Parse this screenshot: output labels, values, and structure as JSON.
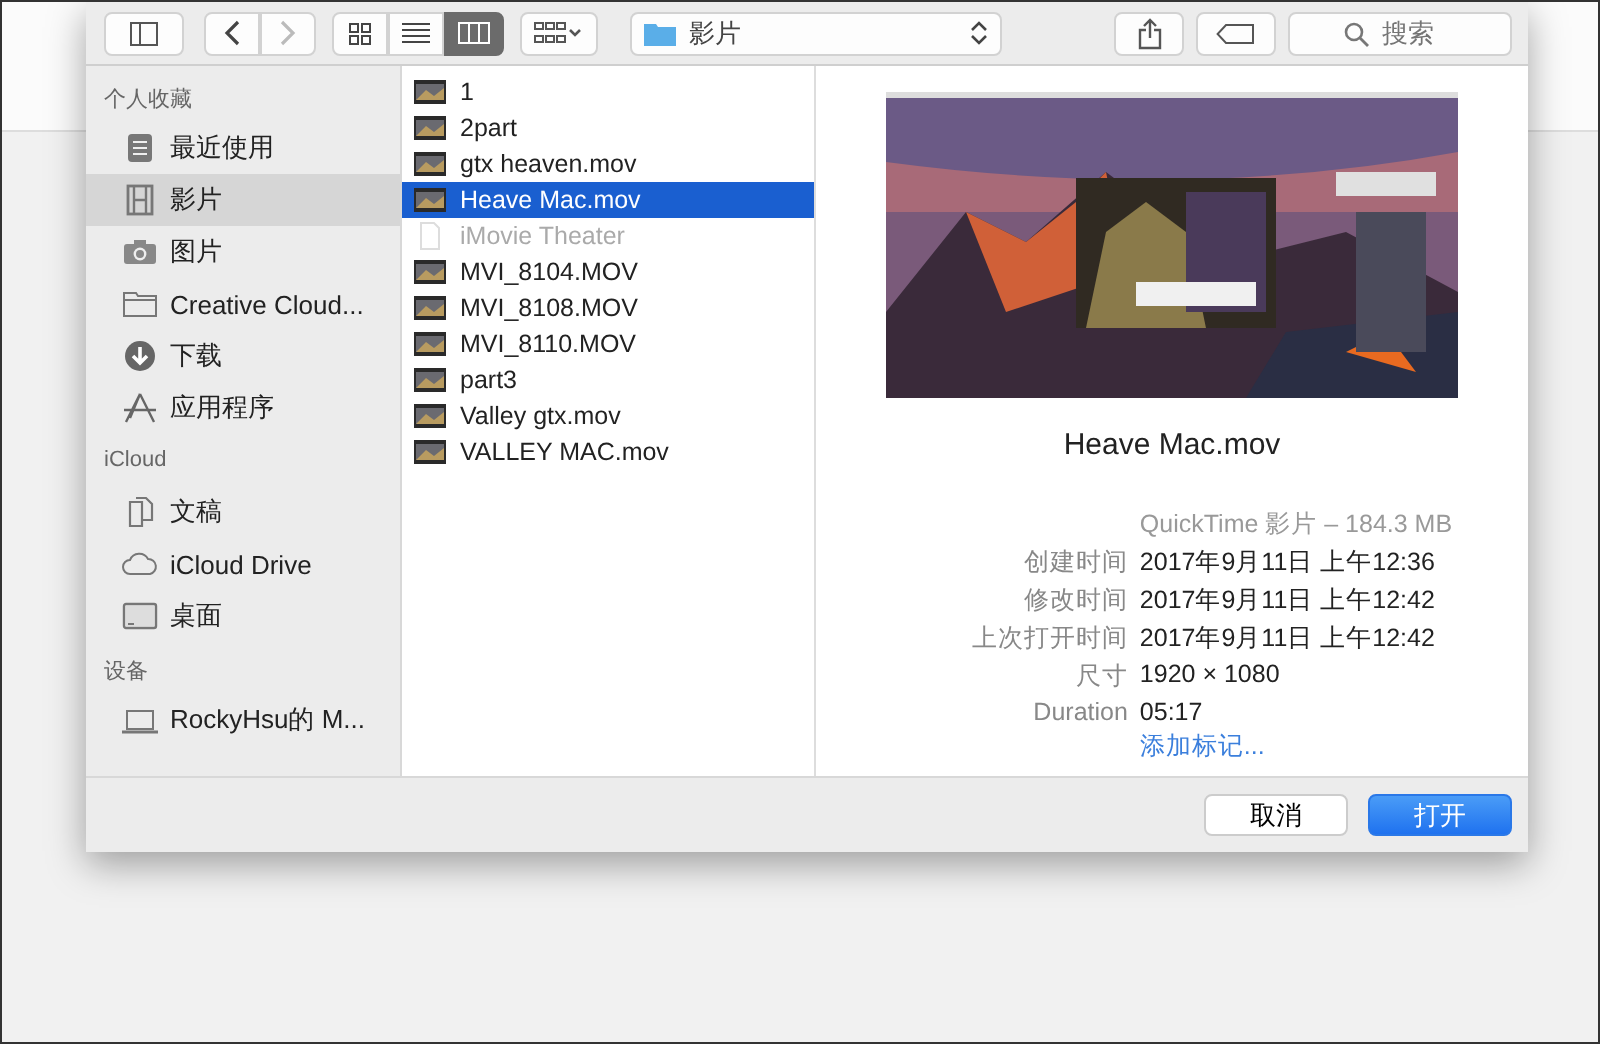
{
  "toolbar": {
    "back_disabled": false,
    "forward_disabled": true,
    "views": [
      {
        "kind": "icons",
        "selected": false
      },
      {
        "kind": "list",
        "selected": false
      },
      {
        "kind": "columns",
        "selected": true
      }
    ],
    "location": "影片",
    "search": {
      "placeholder": "搜索"
    }
  },
  "sidebar": [
    {
      "title": "个人收藏",
      "items": [
        {
          "label": "最近使用",
          "kind": "recent",
          "selected": false
        },
        {
          "label": "影片",
          "kind": "movies",
          "selected": true
        },
        {
          "label": "图片",
          "kind": "camera",
          "selected": false
        },
        {
          "label": "Creative Cloud...",
          "kind": "folder",
          "selected": false
        },
        {
          "label": "下载",
          "kind": "download",
          "selected": false
        },
        {
          "label": "应用程序",
          "kind": "apps",
          "selected": false
        }
      ]
    },
    {
      "title": "iCloud",
      "items": [
        {
          "label": "文稿",
          "kind": "docs",
          "selected": false
        },
        {
          "label": "iCloud Drive",
          "kind": "cloud",
          "selected": false
        },
        {
          "label": "桌面",
          "kind": "desktop",
          "selected": false
        }
      ]
    },
    {
      "title": "设备",
      "items": [
        {
          "label": "RockyHsu的 M...",
          "kind": "laptop",
          "selected": false
        }
      ]
    }
  ],
  "files": [
    {
      "name": "1",
      "kind": "video",
      "selected": false
    },
    {
      "name": "2part",
      "kind": "video",
      "selected": false
    },
    {
      "name": "gtx heaven.mov",
      "kind": "video",
      "selected": false
    },
    {
      "name": "Heave Mac.mov",
      "kind": "video",
      "selected": true
    },
    {
      "name": "iMovie Theater",
      "kind": "document",
      "selected": false
    },
    {
      "name": "MVI_8104.MOV",
      "kind": "video",
      "selected": false
    },
    {
      "name": "MVI_8108.MOV",
      "kind": "video",
      "selected": false
    },
    {
      "name": "MVI_8110.MOV",
      "kind": "video",
      "selected": false
    },
    {
      "name": "part3",
      "kind": "video",
      "selected": false
    },
    {
      "name": "Valley gtx.mov",
      "kind": "video",
      "selected": false
    },
    {
      "name": "VALLEY MAC.mov",
      "kind": "video",
      "selected": false
    }
  ],
  "preview": {
    "title": "Heave Mac.mov",
    "summary": "QuickTime 影片 – 184.3 MB",
    "info": [
      {
        "label": "创建时间",
        "value": "2017年9月11日 上午12:36"
      },
      {
        "label": "修改时间",
        "value": "2017年9月11日 上午12:42"
      },
      {
        "label": "上次打开时间",
        "value": "2017年9月11日 上午12:42"
      },
      {
        "label": "尺寸",
        "value": "1920 × 1080"
      },
      {
        "label": "Duration",
        "value": "05:17"
      }
    ],
    "link": "添加标记..."
  },
  "buttons": [
    {
      "label": "取消",
      "kind": "cancel"
    },
    {
      "label": "打开",
      "kind": "default"
    }
  ]
}
